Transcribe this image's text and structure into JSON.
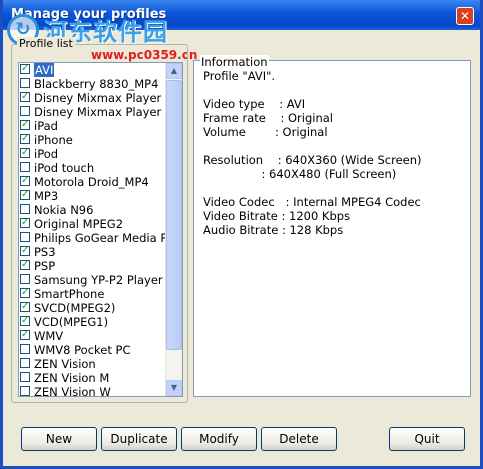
{
  "window": {
    "title": "Manage your profiles",
    "close_glyph": "✕"
  },
  "watermark": {
    "logo_glyph": "↻",
    "title": "河东软件园",
    "url": "www.pc0359.cn"
  },
  "profile_list": {
    "label": "Profile list",
    "items": [
      {
        "label": "AVI",
        "checked": true,
        "selected": true
      },
      {
        "label": "Blackberry 8830_MP4",
        "checked": false,
        "selected": false
      },
      {
        "label": "Disney Mixmax Player",
        "checked": true,
        "selected": false
      },
      {
        "label": "Disney Mixmax Player Plu",
        "checked": false,
        "selected": false
      },
      {
        "label": "iPad",
        "checked": true,
        "selected": false
      },
      {
        "label": "iPhone",
        "checked": true,
        "selected": false
      },
      {
        "label": "iPod",
        "checked": true,
        "selected": false
      },
      {
        "label": "iPod touch",
        "checked": false,
        "selected": false
      },
      {
        "label": "Motorola Droid_MP4",
        "checked": true,
        "selected": false
      },
      {
        "label": "MP3",
        "checked": true,
        "selected": false
      },
      {
        "label": "Nokia N96",
        "checked": false,
        "selected": false
      },
      {
        "label": "Original MPEG2",
        "checked": true,
        "selected": false
      },
      {
        "label": "Philips GoGear Media Play",
        "checked": false,
        "selected": false
      },
      {
        "label": "PS3",
        "checked": true,
        "selected": false
      },
      {
        "label": "PSP",
        "checked": true,
        "selected": false
      },
      {
        "label": "Samsung YP-P2 Player",
        "checked": false,
        "selected": false
      },
      {
        "label": "SmartPhone",
        "checked": true,
        "selected": false
      },
      {
        "label": "SVCD(MPEG2)",
        "checked": true,
        "selected": false
      },
      {
        "label": "VCD(MPEG1)",
        "checked": true,
        "selected": false
      },
      {
        "label": "WMV",
        "checked": true,
        "selected": false
      },
      {
        "label": "WMV8 Pocket PC",
        "checked": false,
        "selected": false
      },
      {
        "label": "ZEN Vision",
        "checked": false,
        "selected": false
      },
      {
        "label": "ZEN Vision M",
        "checked": false,
        "selected": false
      },
      {
        "label": "ZEN Vision W",
        "checked": false,
        "selected": false
      }
    ],
    "scroll_up_glyph": "▲",
    "scroll_down_glyph": "▼"
  },
  "information": {
    "label": "Information",
    "lines": [
      "Profile \"AVI\".",
      "",
      "Video type    : AVI",
      "Frame rate    : Original",
      "Volume        : Original",
      "",
      "Resolution    : 640X360 (Wide Screen)",
      "                : 640X480 (Full Screen)",
      "",
      "Video Codec   : Internal MPEG4 Codec",
      "Video Bitrate : 1200 Kbps",
      "Audio Bitrate : 128 Kbps"
    ]
  },
  "buttons": {
    "new": "New",
    "duplicate": "Duplicate",
    "modify": "Modify",
    "delete": "Delete",
    "quit": "Quit"
  },
  "colors": {
    "titlebar": "#0a55d8",
    "selection": "#316ac5",
    "check": "#21a121",
    "dialog_bg": "#ece9d8"
  }
}
